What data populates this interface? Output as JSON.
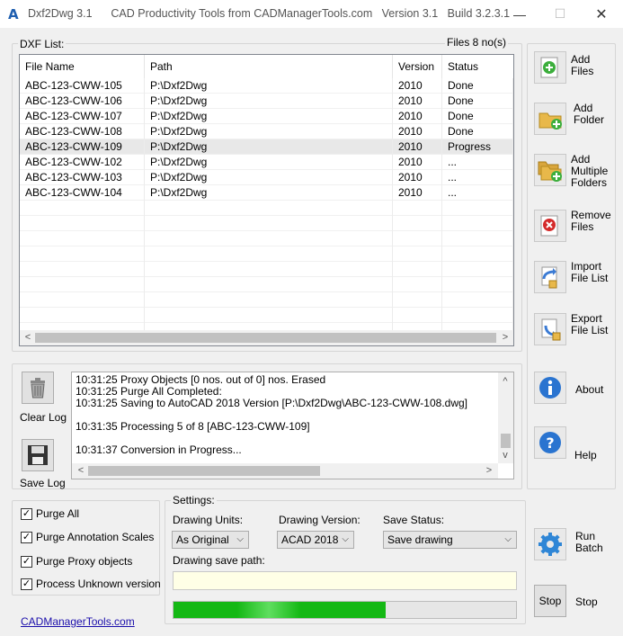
{
  "window": {
    "app_icon_glyph": "A",
    "title": "Dxf2Dwg 3.1      CAD Productivity Tools from CADManagerTools.com   Version 3.1   Build 3.2.3.1",
    "minimize": "—",
    "maximize": "☐",
    "close": "✕"
  },
  "dxf_list": {
    "group_label": "DXF List:",
    "files_count": "Files 8 no(s)",
    "columns": [
      "File Name",
      "Path",
      "Version",
      "Status"
    ],
    "rows": [
      {
        "name": "ABC-123-CWW-105",
        "path": "P:\\Dxf2Dwg",
        "version": "2010",
        "status": "Done"
      },
      {
        "name": "ABC-123-CWW-106",
        "path": "P:\\Dxf2Dwg",
        "version": "2010",
        "status": "Done"
      },
      {
        "name": "ABC-123-CWW-107",
        "path": "P:\\Dxf2Dwg",
        "version": "2010",
        "status": "Done"
      },
      {
        "name": "ABC-123-CWW-108",
        "path": "P:\\Dxf2Dwg",
        "version": "2010",
        "status": "Done"
      },
      {
        "name": "ABC-123-CWW-109",
        "path": "P:\\Dxf2Dwg",
        "version": "2010",
        "status": "Progress"
      },
      {
        "name": "ABC-123-CWW-102",
        "path": "P:\\Dxf2Dwg",
        "version": "2010",
        "status": "..."
      },
      {
        "name": "ABC-123-CWW-103",
        "path": "P:\\Dxf2Dwg",
        "version": "2010",
        "status": "..."
      },
      {
        "name": "ABC-123-CWW-104",
        "path": "P:\\Dxf2Dwg",
        "version": "2010",
        "status": "..."
      }
    ],
    "selected_row": 4,
    "scroll_left": "<",
    "scroll_right": ">"
  },
  "side_buttons": {
    "add_files": "Add\nFiles",
    "add_folder": "Add\nFolder",
    "add_multiple_folders": "Add\nMultiple\nFolders",
    "remove_files": "Remove\nFiles",
    "import_file_list": "Import\nFile List",
    "export_file_list": "Export\nFile List",
    "about": "About",
    "help": "Help",
    "run_batch": "Run\nBatch",
    "stop": "Stop"
  },
  "log": {
    "clear_label": "Clear Log",
    "save_label": "Save Log",
    "lines": [
      "10:31:25 Proxy Objects [0 nos. out of 0] nos. Erased",
      "10:31:25 Purge All Completed:",
      "10:31:25 Saving to AutoCAD 2018 Version [P:\\Dxf2Dwg\\ABC-123-CWW-108.dwg]",
      "",
      "10:31:35 Processing 5 of 8 [ABC-123-CWW-109]",
      "",
      "10:31:37 Conversion in Progress..."
    ],
    "scroll_up": "^",
    "scroll_down": "v",
    "scroll_left": "<",
    "scroll_right": ">"
  },
  "options": {
    "purge_all": {
      "label": "Purge All",
      "checked": true
    },
    "purge_annotation": {
      "label": "Purge Annotation Scales",
      "checked": true
    },
    "purge_proxy": {
      "label": "Purge Proxy objects",
      "checked": true
    },
    "process_unknown": {
      "label": "Process Unknown version",
      "checked": true
    },
    "check_mark": "✓"
  },
  "settings": {
    "group_label": "Settings:",
    "units_label": "Drawing Units:",
    "units_value": "As Original",
    "version_label": "Drawing Version:",
    "version_value": "ACAD 2018",
    "save_status_label": "Save Status:",
    "save_status_value": "Save drawing",
    "save_path_label": "Drawing save path:",
    "save_path_value": "",
    "caret": "⌵",
    "progress": 0.62,
    "stop_button": "Stop"
  },
  "footer": {
    "link": "CADManagerTools.com"
  },
  "colors": {
    "progress_green": "#14b814",
    "path_field_bg": "#ffffe6",
    "link_blue": "#1a0dab"
  }
}
